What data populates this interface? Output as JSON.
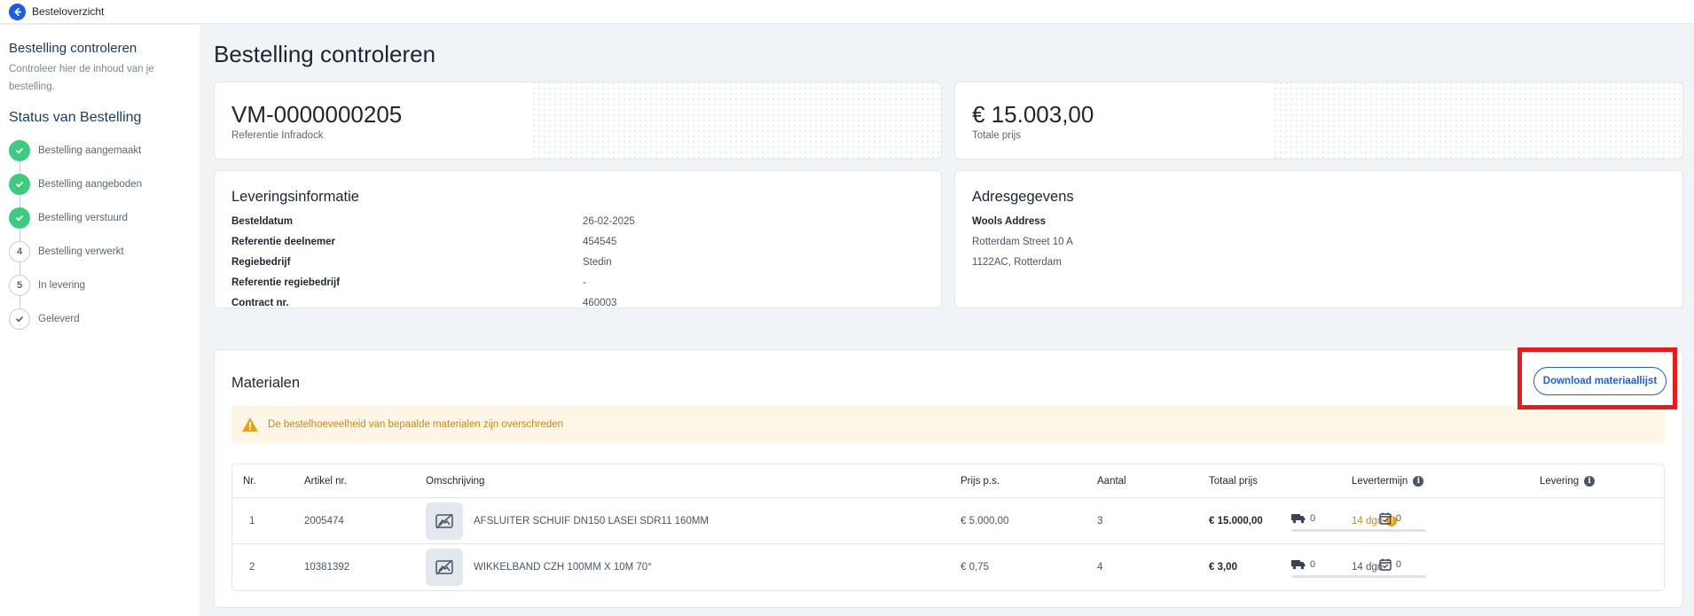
{
  "topbar": {
    "back_label": "Besteloverzicht"
  },
  "sidebar": {
    "title": "Bestelling controleren",
    "description": "Controleer hier de inhoud van je bestelling.",
    "status_title": "Status van Bestelling",
    "steps": [
      {
        "marker": "",
        "label": "Bestelling aangemaakt",
        "state": "done"
      },
      {
        "marker": "",
        "label": "Bestelling aangeboden",
        "state": "done"
      },
      {
        "marker": "",
        "label": "Bestelling verstuurd",
        "state": "done"
      },
      {
        "marker": "4",
        "label": "Bestelling verwerkt",
        "state": "todo"
      },
      {
        "marker": "5",
        "label": "In levering",
        "state": "todo"
      },
      {
        "marker": "",
        "label": "Geleverd",
        "state": "todo"
      }
    ]
  },
  "main": {
    "title": "Bestelling controleren",
    "reference": {
      "value": "VM-0000000205",
      "label": "Referentie Infradock"
    },
    "total": {
      "value": "€ 15.003,00",
      "label": "Totale prijs"
    },
    "delivery_info": {
      "title": "Leveringsinformatie",
      "rows": [
        {
          "key": "Besteldatum",
          "value": "26-02-2025"
        },
        {
          "key": "Referentie deelnemer",
          "value": "454545"
        },
        {
          "key": "Regiebedrijf",
          "value": "Stedin"
        },
        {
          "key": "Referentie regiebedrijf",
          "value": "-"
        },
        {
          "key": "Contract nr.",
          "value": "460003"
        }
      ]
    },
    "address": {
      "title": "Adresgegevens",
      "name": "Wools Address",
      "street": "Rotterdam Street 10 A",
      "city": "1122AC, Rotterdam"
    },
    "materials": {
      "title": "Materialen",
      "download_label": "Download materiaallijst",
      "warning": "De bestelhoeveelheid van bepaalde materialen zijn overschreden",
      "columns": [
        "Nr.",
        "Artikel nr.",
        "Omschrijving",
        "Prijs p.s.",
        "Aantal",
        "Totaal prijs",
        "Levertermijn",
        "Levering"
      ],
      "rows": [
        {
          "nr": "1",
          "artikel": "2005474",
          "omschrijving": "AFSLUITER SCHUIF DN150 LASEI SDR11 160MM",
          "prijs": "€ 5.000,00",
          "aantal": "3",
          "totaal": "€ 15.000,00",
          "levertermijn": "14 dgn",
          "levering_truck": "0",
          "levering_cal": "0"
        },
        {
          "nr": "2",
          "artikel": "10381392",
          "omschrijving": "WIKKELBAND CZH 100MM X 10M 70°",
          "prijs": "€ 0,75",
          "aantal": "4",
          "totaal": "€ 3,00",
          "levertermijn": "14 dgn",
          "levering_truck": "0",
          "levering_cal": "0"
        }
      ]
    }
  },
  "colors": {
    "accent": "#1d5fd6",
    "success": "#3fcb7f",
    "warning": "#c8891a",
    "highlight": "#e31c1c"
  }
}
